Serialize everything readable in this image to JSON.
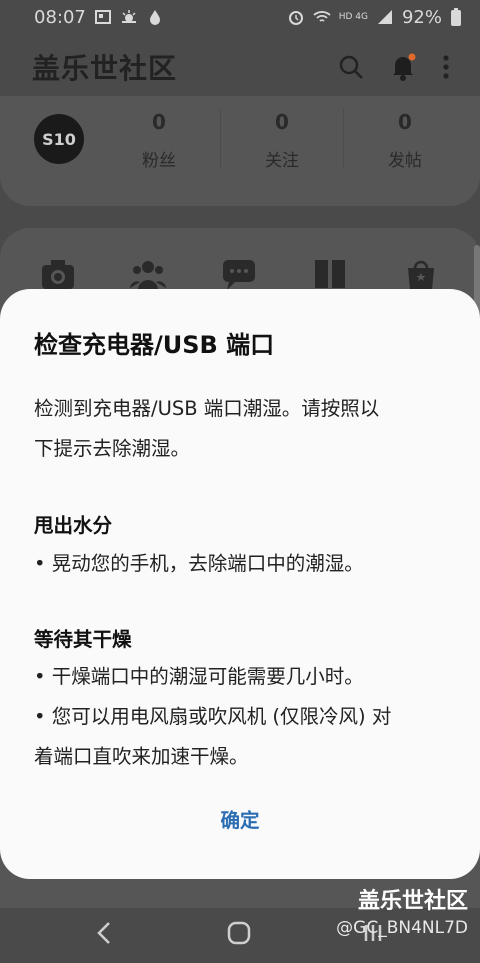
{
  "status_bar": {
    "time": "08:07",
    "battery": "92%",
    "network": "HD 4G"
  },
  "app": {
    "title": "盖乐世社区",
    "icons": [
      "search-icon",
      "bell-icon",
      "more-vert-icon"
    ],
    "notification_dot_color": "#e06a2c"
  },
  "profile": {
    "avatar_text": "S10",
    "stats": [
      {
        "value": "0",
        "label": "粉丝"
      },
      {
        "value": "0",
        "label": "关注"
      },
      {
        "value": "0",
        "label": "发帖"
      }
    ]
  },
  "menu_icons": [
    "camera-icon",
    "group-icon",
    "chat-icon",
    "book-icon",
    "shop-icon"
  ],
  "dialog": {
    "title": "检查充电器/USB 端口",
    "message_line1": "检测到充电器/USB 端口潮湿。请按照以",
    "message_line2": "下提示去除潮湿。",
    "section1_title": "甩出水分",
    "section1_item": "• 晃动您的手机，去除端口中的潮湿。",
    "section2_title": "等待其干燥",
    "section2_item1": "• 干燥端口中的潮湿可能需要几小时。",
    "section2_item2_line1": "• 您可以用电风扇或吹风机 (仅限冷风) 对",
    "section2_item2_line2": "着端口直吹来加速干燥。",
    "confirm_label": "确定",
    "accent_color": "#2a6db3"
  },
  "nav_bar": {
    "buttons": [
      "back-icon",
      "home-icon",
      "recents-icon"
    ]
  },
  "watermark": {
    "title": "盖乐世社区",
    "user": "@GC_BN4NL7D"
  }
}
